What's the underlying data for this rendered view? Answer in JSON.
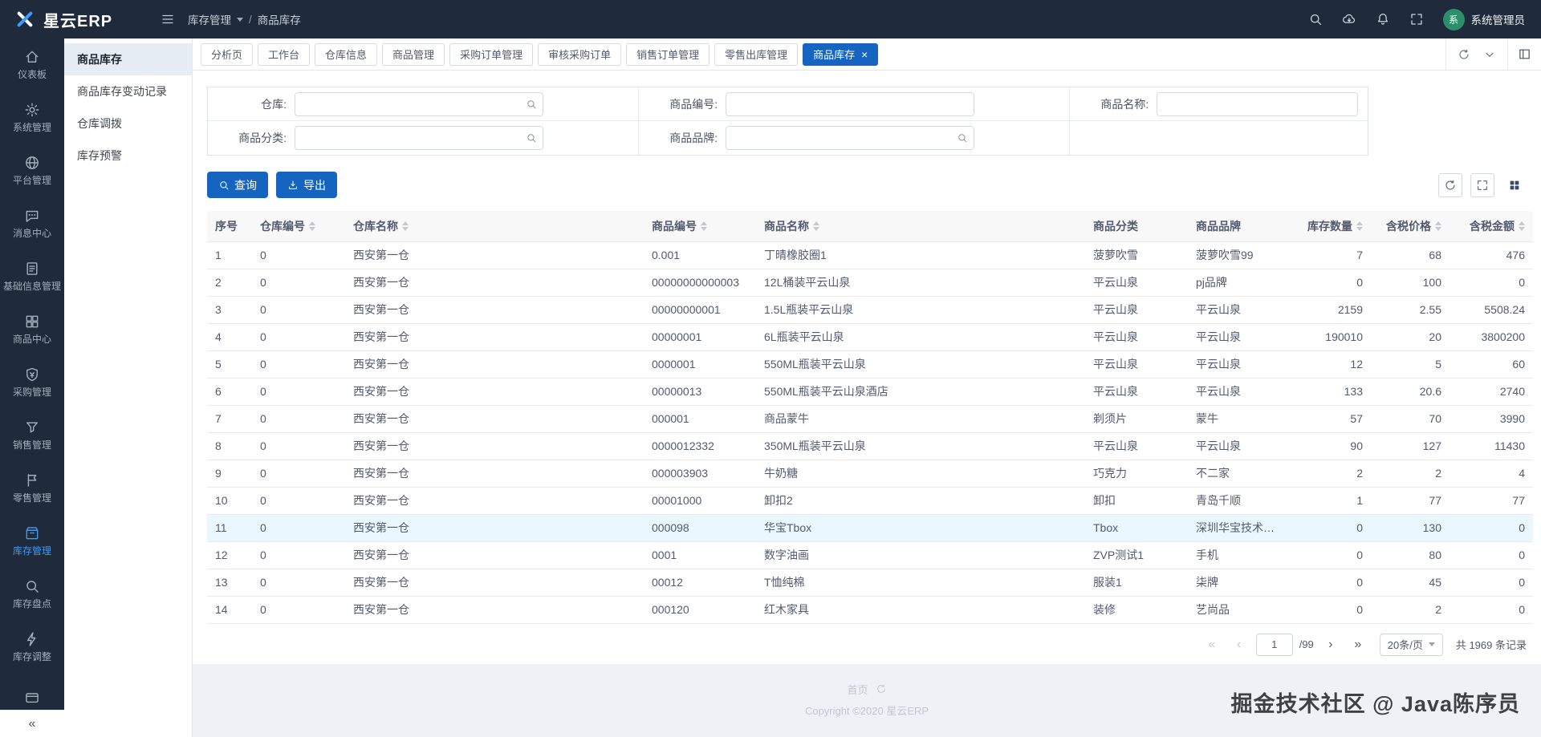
{
  "colors": {
    "header_bg": "#1f2b3a",
    "accent": "#1564c0",
    "active_menu": "#3d9af5",
    "avatar_bg": "#2b8f6b"
  },
  "header": {
    "logo_text": "星云ERP",
    "breadcrumb": {
      "level1": "库存管理",
      "separator": "/",
      "level2": "商品库存"
    },
    "icons": [
      {
        "name": "search-icon"
      },
      {
        "name": "cloud-download-icon"
      },
      {
        "name": "bell-icon"
      },
      {
        "name": "fullscreen-icon"
      }
    ],
    "user": {
      "avatar_char": "系",
      "name": "系统管理员"
    }
  },
  "icon_sidebar": {
    "items": [
      {
        "key": "dashboard",
        "label": "仪表板",
        "icon": "home-icon",
        "active": false
      },
      {
        "key": "system-management",
        "label": "系统管理",
        "icon": "gear-icon",
        "active": false
      },
      {
        "key": "platform-management",
        "label": "平台管理",
        "icon": "globe-icon",
        "active": false
      },
      {
        "key": "message-center",
        "label": "消息中心",
        "icon": "message-icon",
        "active": false
      },
      {
        "key": "base-info-management",
        "label": "基础信息管理",
        "icon": "doc-icon",
        "active": false
      },
      {
        "key": "product-center",
        "label": "商品中心",
        "icon": "grid-icon",
        "active": false
      },
      {
        "key": "purchase-management",
        "label": "采购管理",
        "icon": "shield-icon",
        "active": false
      },
      {
        "key": "sales-management",
        "label": "销售管理",
        "icon": "funnel-icon",
        "active": false
      },
      {
        "key": "retail-management",
        "label": "零售管理",
        "icon": "flag-icon",
        "active": false
      },
      {
        "key": "inventory-management",
        "label": "库存管理",
        "icon": "box-icon",
        "active": true
      },
      {
        "key": "stock-taking",
        "label": "库存盘点",
        "icon": "magnifier-icon",
        "active": false
      },
      {
        "key": "stock-adjust",
        "label": "库存调整",
        "icon": "bolt-icon",
        "active": false
      },
      {
        "key": "extra",
        "label": "",
        "icon": "card-icon",
        "active": false
      }
    ],
    "collapse_glyph": "«"
  },
  "sub_sidebar": {
    "items": [
      {
        "key": "product-stock",
        "label": "商品库存",
        "active": true
      },
      {
        "key": "stock-change-log",
        "label": "商品库存变动记录",
        "active": false
      },
      {
        "key": "warehouse-transfer",
        "label": "仓库调拨",
        "active": false
      },
      {
        "key": "stock-warning",
        "label": "库存预警",
        "active": false
      }
    ]
  },
  "tabs": {
    "close_glyph": "×",
    "items": [
      {
        "key": "analysis",
        "label": "分析页",
        "active": false
      },
      {
        "key": "workbench",
        "label": "工作台",
        "active": false
      },
      {
        "key": "warehouse-info",
        "label": "仓库信息",
        "active": false
      },
      {
        "key": "product-management",
        "label": "商品管理",
        "active": false
      },
      {
        "key": "purchase-order-management",
        "label": "采购订单管理",
        "active": false
      },
      {
        "key": "purchase-order-audit",
        "label": "审核采购订单",
        "active": false
      },
      {
        "key": "sales-order-management",
        "label": "销售订单管理",
        "active": false
      },
      {
        "key": "retail-outbound-management",
        "label": "零售出库管理",
        "active": false
      },
      {
        "key": "product-stock",
        "label": "商品库存",
        "active": true
      }
    ],
    "tools": [
      {
        "name": "refresh-icon"
      },
      {
        "name": "chevron-down-icon"
      }
    ],
    "layout_tool": "layout-icon"
  },
  "filters": {
    "fields": [
      {
        "key": "warehouse",
        "label": "仓库:",
        "value": "",
        "placeholder": "",
        "search_icon": true
      },
      {
        "key": "product-code",
        "label": "商品编号:",
        "value": "",
        "placeholder": "",
        "search_icon": false
      },
      {
        "key": "product-name",
        "label": "商品名称:",
        "value": "",
        "placeholder": "",
        "search_icon": false
      },
      {
        "key": "product-category",
        "label": "商品分类:",
        "value": "",
        "placeholder": "",
        "search_icon": true
      },
      {
        "key": "product-brand",
        "label": "商品品牌:",
        "value": "",
        "placeholder": "",
        "search_icon": true
      }
    ]
  },
  "toolbar": {
    "query_label": "查询",
    "export_label": "导出",
    "right_icons": [
      {
        "name": "refresh-icon"
      },
      {
        "name": "expand-icon"
      },
      {
        "name": "columns-icon"
      }
    ]
  },
  "table": {
    "hover_row_index": 10,
    "columns": [
      {
        "key": "index",
        "label": "序号",
        "sortable": false
      },
      {
        "key": "warehouse-code",
        "label": "仓库编号",
        "sortable": true
      },
      {
        "key": "warehouse-name",
        "label": "仓库名称",
        "sortable": true
      },
      {
        "key": "product-code",
        "label": "商品编号",
        "sortable": true
      },
      {
        "key": "product-name",
        "label": "商品名称",
        "sortable": true
      },
      {
        "key": "product-category",
        "label": "商品分类",
        "sortable": false
      },
      {
        "key": "product-brand",
        "label": "商品品牌",
        "sortable": false
      },
      {
        "key": "stock-qty",
        "label": "库存数量",
        "sortable": true
      },
      {
        "key": "tax-price",
        "label": "含税价格",
        "sortable": true
      },
      {
        "key": "tax-amount",
        "label": "含税金额",
        "sortable": true
      }
    ],
    "rows": [
      [
        "1",
        "0",
        "西安第一仓",
        "0.001",
        "丁晴橡胶圈1",
        "菠萝吹雪",
        "菠萝吹雪99",
        "7",
        "68",
        "476"
      ],
      [
        "2",
        "0",
        "西安第一仓",
        "00000000000003",
        "12L桶装平云山泉",
        "平云山泉",
        "pj品牌",
        "0",
        "100",
        "0"
      ],
      [
        "3",
        "0",
        "西安第一仓",
        "00000000001",
        "1.5L瓶装平云山泉",
        "平云山泉",
        "平云山泉",
        "2159",
        "2.55",
        "5508.24"
      ],
      [
        "4",
        "0",
        "西安第一仓",
        "00000001",
        "6L瓶装平云山泉",
        "平云山泉",
        "平云山泉",
        "190010",
        "20",
        "3800200"
      ],
      [
        "5",
        "0",
        "西安第一仓",
        "0000001",
        "550ML瓶装平云山泉",
        "平云山泉",
        "平云山泉",
        "12",
        "5",
        "60"
      ],
      [
        "6",
        "0",
        "西安第一仓",
        "00000013",
        "550ML瓶装平云山泉酒店",
        "平云山泉",
        "平云山泉",
        "133",
        "20.6",
        "2740"
      ],
      [
        "7",
        "0",
        "西安第一仓",
        "000001",
        "商品蒙牛",
        "剃须片",
        "蒙牛",
        "57",
        "70",
        "3990"
      ],
      [
        "8",
        "0",
        "西安第一仓",
        "0000012332",
        "350ML瓶装平云山泉",
        "平云山泉",
        "平云山泉",
        "90",
        "127",
        "11430"
      ],
      [
        "9",
        "0",
        "西安第一仓",
        "000003903",
        "牛奶糖",
        "巧克力",
        "不二家",
        "2",
        "2",
        "4"
      ],
      [
        "10",
        "0",
        "西安第一仓",
        "00001000",
        "卸扣2",
        "卸扣",
        "青岛千顺",
        "1",
        "77",
        "77"
      ],
      [
        "11",
        "0",
        "西安第一仓",
        "000098",
        "华宝Tbox",
        "Tbox",
        "深圳华宝技术有...",
        "0",
        "130",
        "0"
      ],
      [
        "12",
        "0",
        "西安第一仓",
        "0001",
        "数字油画",
        "ZVP测试1",
        "手机",
        "0",
        "80",
        "0"
      ],
      [
        "13",
        "0",
        "西安第一仓",
        "00012",
        "T恤纯棉",
        "服装1",
        "柒牌",
        "0",
        "45",
        "0"
      ],
      [
        "14",
        "0",
        "西安第一仓",
        "000120",
        "红木家具",
        "装修",
        "艺尚品",
        "0",
        "2",
        "0"
      ]
    ]
  },
  "pagination": {
    "first_glyph": "«",
    "prev_glyph": "‹",
    "current_page": "1",
    "total_pages_label": "/99",
    "next_glyph": "›",
    "last_glyph": "»",
    "page_size_label": "20条/页",
    "total_label": "共 1969 条记录"
  },
  "footer": {
    "home_label": "首页",
    "copyright": "Copyright ©2020 星云ERP",
    "watermark": "掘金技术社区 @ Java陈序员"
  }
}
